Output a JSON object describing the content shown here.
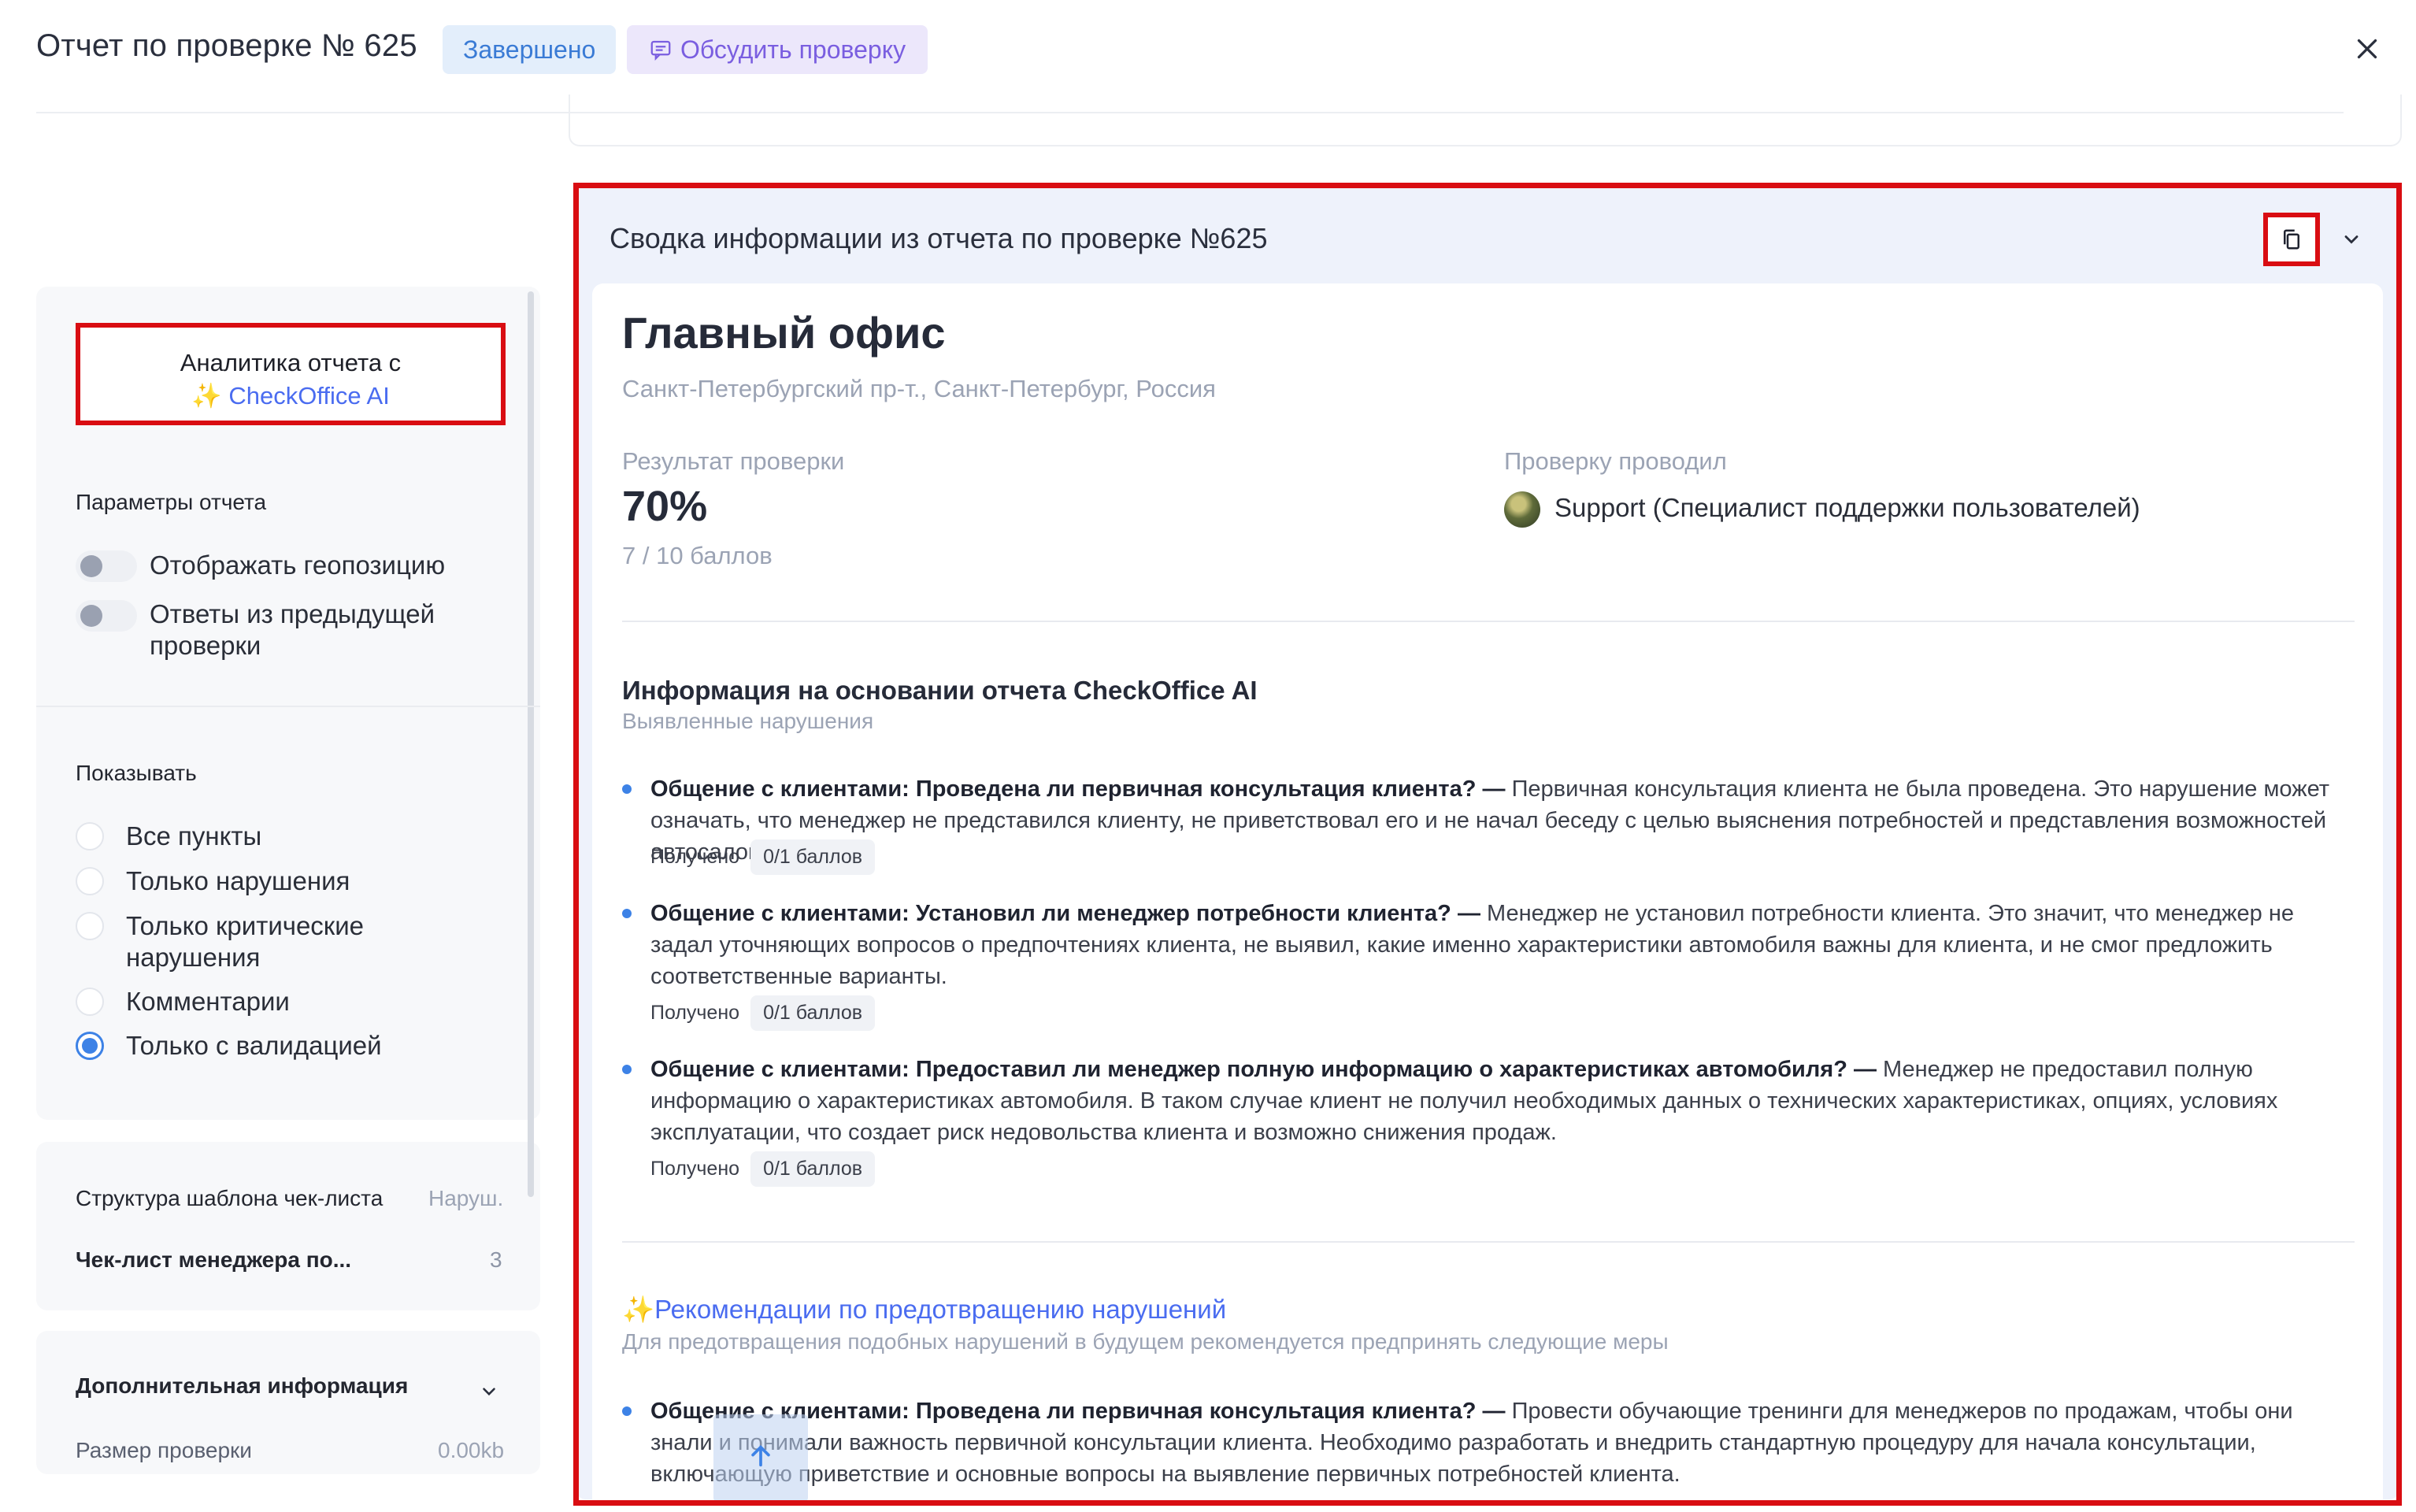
{
  "header": {
    "title": "Отчет по проверке № 625",
    "status_badge": "Завершено",
    "discuss_button": "Обсудить проверку"
  },
  "sidebar": {
    "ai_button": {
      "line1": "Аналитика отчета с",
      "line2_spark": "✨",
      "line2_brand": "CheckOffice AI"
    },
    "report_params": {
      "title": "Параметры отчета",
      "toggles": [
        {
          "label": "Отображать геопозицию",
          "on": false
        },
        {
          "label": "Ответы из предыдущей проверки",
          "on": false
        }
      ]
    },
    "show": {
      "title": "Показывать",
      "options": [
        {
          "label": "Все пункты",
          "selected": false
        },
        {
          "label": "Только нарушения",
          "selected": false
        },
        {
          "label": "Только критические нарушения",
          "selected": false
        },
        {
          "label": "Комментарии",
          "selected": false
        },
        {
          "label": "Только с валидацией",
          "selected": true
        }
      ]
    },
    "structure": {
      "title": "Структура шаблона чек-листа",
      "right_label": "Наруш.",
      "checklist_name": "Чек-лист менеджера по...",
      "checklist_count": "3"
    },
    "additional": {
      "title": "Дополнительная информация",
      "size_label": "Размер проверки",
      "size_value": "0.00kb"
    }
  },
  "summary": {
    "panel_title": "Сводка информации из отчета по проверке №625",
    "office_name": "Главный офис",
    "address": "Санкт-Петербургский пр-т., Санкт-Петербург, Россия",
    "result_label": "Результат проверки",
    "result_pct": "70%",
    "result_points": "7 / 10 баллов",
    "inspector_label": "Проверку проводил",
    "inspector_name": "Support (Специалист поддержки пользователей)",
    "ai_section": {
      "title": "Информация на основании отчета CheckOffice AI",
      "subtitle": "Выявленные нарушения",
      "items": [
        {
          "question": "Общение с клиентами: Проведена ли первичная консультация клиента? —",
          "text": " Первичная консультация клиента не была проведена. Это нарушение может означать, что менеджер не представился клиенту, не приветствовал его и не начал беседу с целью выяснения потребностей и представления возможностей автосалона.",
          "got_label": "Получено",
          "score": "0/1 баллов"
        },
        {
          "question": "Общение с клиентами: Установил ли менеджер потребности клиента? —",
          "text": " Менеджер не установил потребности клиента. Это значит, что менеджер не задал уточняющих вопросов о предпочтениях клиента, не выявил, какие именно характеристики автомобиля важны для клиента, и не смог предложить соответственные варианты.",
          "got_label": "Получено",
          "score": "0/1 баллов"
        },
        {
          "question": "Общение с клиентами: Предоставил ли менеджер полную информацию о характеристиках автомобиля? —",
          "text": " Менеджер не предоставил полную информацию о характеристиках автомобиля. В таком случае клиент не получил необходимых данных о технических характеристиках, опциях, условиях эксплуатации, что создает риск недовольства клиента и возможно снижения продаж.",
          "got_label": "Получено",
          "score": "0/1 баллов"
        }
      ]
    },
    "recommendations": {
      "spark": "✨",
      "title": "Рекомендации по предотвращению нарушений",
      "subtitle": "Для предотвращения подобных нарушений в будущем рекомендуется предпринять следующие меры",
      "items": [
        {
          "question": "Общение с клиентами: Проведена ли первичная консультация клиента? —",
          "text": " Провести обучающие тренинги для менеджеров по продажам, чтобы они знали и понимали важность первичной консультации клиента. Необходимо разработать и внедрить стандартную процедуру для начала консультации, включающую приветствие и основные вопросы на выявление первичных потребностей клиента."
        }
      ]
    }
  }
}
